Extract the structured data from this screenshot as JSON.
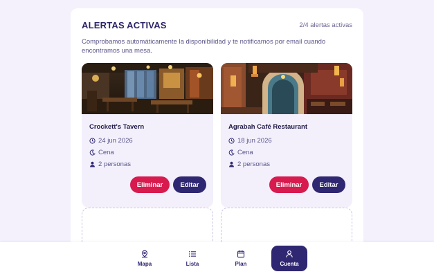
{
  "panel": {
    "title": "ALERTAS ACTIVAS",
    "count": "2/4 alertas activas",
    "description": "Comprobamos automáticamente la disponibilidad y te notificamos por email cuando encontramos una mesa."
  },
  "alerts": [
    {
      "name": "Crockett's Tavern",
      "date": "24 jun 2026",
      "meal": "Cena",
      "guests": "2 personas",
      "delete_label": "Eliminar",
      "edit_label": "Editar"
    },
    {
      "name": "Agrabah Café Restaurant",
      "date": "18 jun 2026",
      "meal": "Cena",
      "guests": "2 personas",
      "delete_label": "Eliminar",
      "edit_label": "Editar"
    }
  ],
  "nav": {
    "items": [
      {
        "label": "Mapa",
        "icon": "map-pin-icon"
      },
      {
        "label": "Lista",
        "icon": "list-icon"
      },
      {
        "label": "Plan",
        "icon": "calendar-icon"
      },
      {
        "label": "Cuenta",
        "icon": "user-icon",
        "active": true
      }
    ]
  },
  "colors": {
    "primary": "#2f2771",
    "danger": "#d81b4f",
    "background": "#f4f1fd",
    "card": "#f3f0fc"
  }
}
